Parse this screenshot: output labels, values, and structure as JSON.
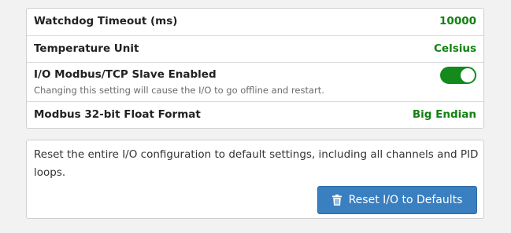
{
  "settings": {
    "rows": [
      {
        "label": "Watchdog Timeout (ms)",
        "value": "10000"
      },
      {
        "label": "Temperature Unit",
        "value": "Celsius"
      },
      {
        "label": "I/O Modbus/TCP Slave Enabled",
        "description": "Changing this setting will cause the I/O to go offline and restart.",
        "enabled": true
      },
      {
        "label": "Modbus 32-bit Float Format",
        "value": "Big Endian"
      }
    ]
  },
  "reset": {
    "description": "Reset the entire I/O configuration to default settings, including all channels and PID loops.",
    "button_label": "Reset I/O to Defaults",
    "button_icon": "trash-icon"
  },
  "colors": {
    "value_green": "#128212",
    "toggle_on": "#138a1b",
    "button_blue": "#3a7fc0"
  }
}
